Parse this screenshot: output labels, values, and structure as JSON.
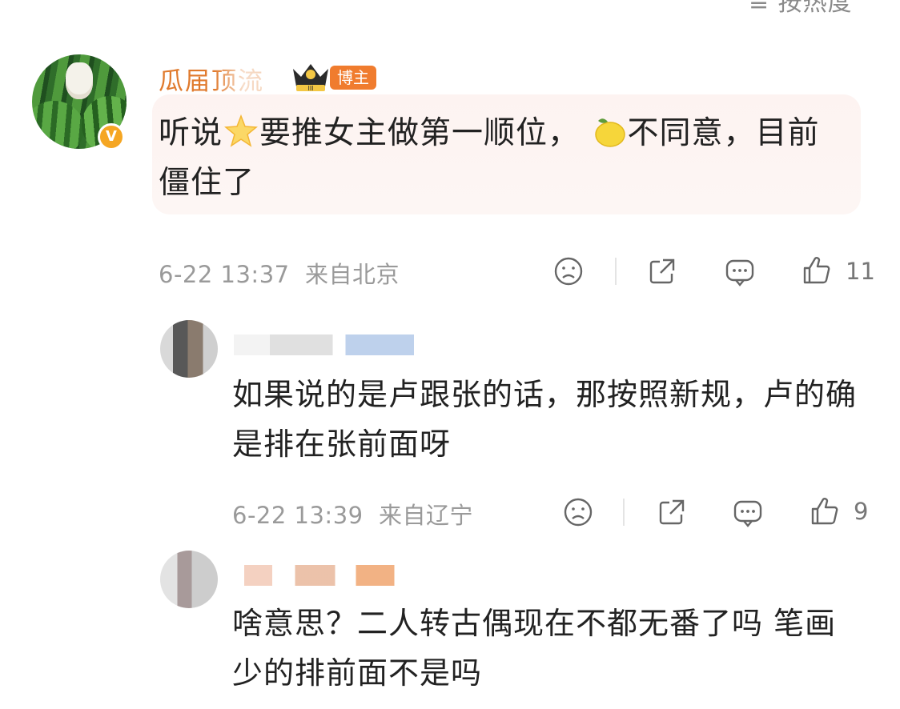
{
  "header": {
    "sort_label": "≡ 按热度"
  },
  "main_comment": {
    "username": "瓜届顶流",
    "author_badge": "博主",
    "crown_level": "III",
    "verified_badge": "V",
    "text_part1": "听说",
    "text_part2": "要推女主做第一顺位，",
    "text_part3": "不同意，目前僵住了",
    "emoji_1": "star-emoji",
    "emoji_2": "lemon-emoji",
    "time": "6-22 13:37",
    "location": "来自北京",
    "like_count": "11"
  },
  "replies": [
    {
      "text": "如果说的是卢跟张的话，那按照新规，卢的确是排在张前面呀",
      "time": "6-22 13:39",
      "location": "来自辽宁",
      "like_count": "9"
    },
    {
      "text": "啥意思？二人转古偶现在不都无番了吗 笔画少的排前面不是吗"
    }
  ],
  "icons": [
    "sad-face-icon",
    "share-icon",
    "comment-icon",
    "thumbs-up-icon"
  ],
  "colors": {
    "username": "#e07a2d",
    "badge": "#f07c2e",
    "bubble": "#fdf3f1",
    "meta": "#9a9a9a"
  }
}
